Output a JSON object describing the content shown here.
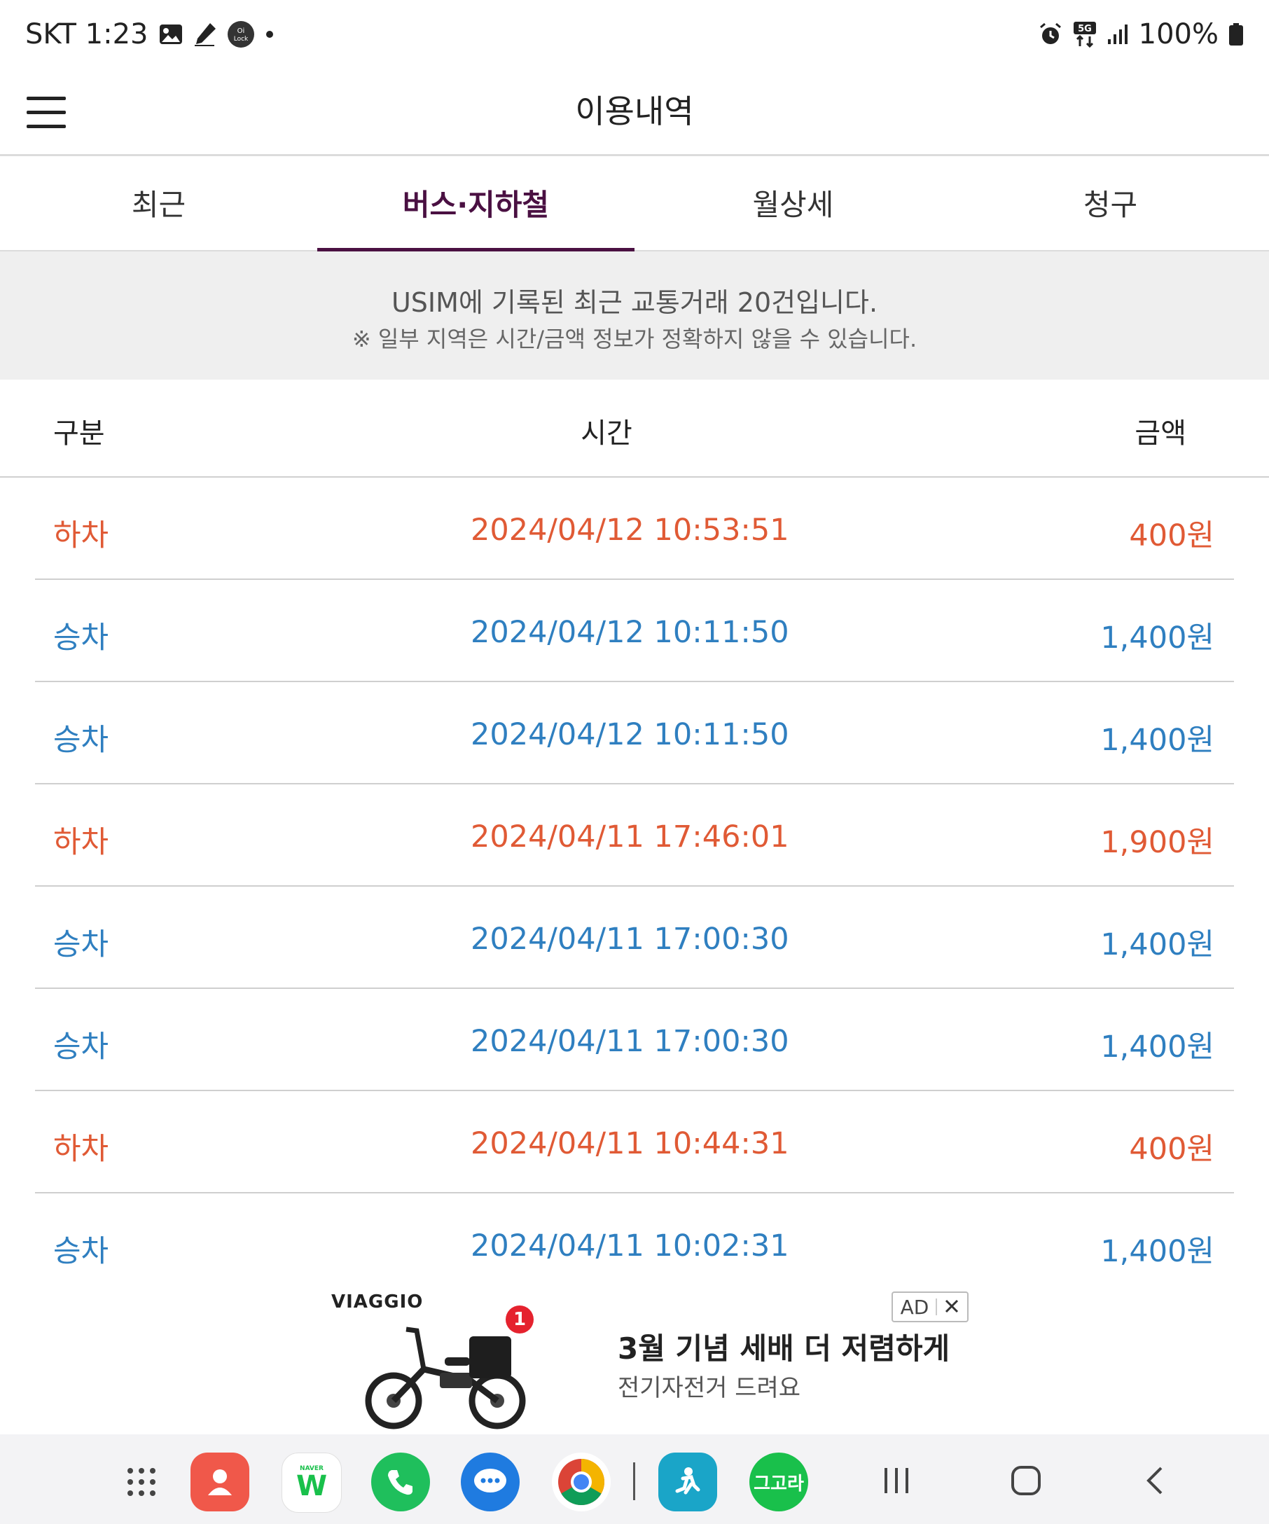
{
  "status_bar": {
    "carrier_time": "SKT 1:23",
    "battery": "100%",
    "lock_badge": "Oi Lock",
    "network": "5G",
    "icons": [
      "gallery-icon",
      "pen-icon",
      "lock-app-icon",
      "dot-icon",
      "alarm-icon",
      "5g-icon",
      "signal-icon",
      "battery-icon"
    ]
  },
  "header": {
    "title": "이용내역",
    "menu_icon": "hamburger-menu-icon"
  },
  "tabs": [
    {
      "label": "최근",
      "active": false
    },
    {
      "label": "버스·지하철",
      "active": true
    },
    {
      "label": "월상세",
      "active": false
    },
    {
      "label": "청구",
      "active": false
    }
  ],
  "notice": {
    "line1": "USIM에 기록된 최근 교통거래 20건입니다.",
    "line2": "※ 일부 지역은 시간/금액 정보가 정확하지 않을 수 있습니다."
  },
  "table": {
    "headers": {
      "type": "구분",
      "time": "시간",
      "amount": "금액"
    },
    "rows": [
      {
        "type": "하차",
        "time": "2024/04/12 10:53:51",
        "amount": "400원"
      },
      {
        "type": "승차",
        "time": "2024/04/12 10:11:50",
        "amount": "1,400원"
      },
      {
        "type": "승차",
        "time": "2024/04/12 10:11:50",
        "amount": "1,400원"
      },
      {
        "type": "하차",
        "time": "2024/04/11 17:46:01",
        "amount": "1,900원"
      },
      {
        "type": "승차",
        "time": "2024/04/11 17:00:30",
        "amount": "1,400원"
      },
      {
        "type": "승차",
        "time": "2024/04/11 17:00:30",
        "amount": "1,400원"
      },
      {
        "type": "하차",
        "time": "2024/04/11 10:44:31",
        "amount": "400원"
      },
      {
        "type": "승차",
        "time": "2024/04/11 10:02:31",
        "amount": "1,400원"
      }
    ],
    "colors": {
      "alight": "#e05a35",
      "board": "#2f7fc0"
    }
  },
  "ad": {
    "brand": "VIAGGIO",
    "badge": "AD",
    "notification_count": "1",
    "headline": "3월 기념 세배 더 저렴하게",
    "subline": "전기자전거 드려요"
  },
  "taskbar": {
    "apps": [
      {
        "name": "app-drawer-icon"
      },
      {
        "name": "contacts-icon",
        "color": "#f0584a"
      },
      {
        "name": "naver-whale-icon",
        "label": "W",
        "brand": "NAVER"
      },
      {
        "name": "phone-icon",
        "color": "#1fbf5c"
      },
      {
        "name": "messages-icon",
        "color": "#1f7be0"
      },
      {
        "name": "chrome-icon"
      },
      {
        "name": "fitness-icon",
        "color": "#1aa5c8"
      },
      {
        "name": "gogora-icon",
        "label": "그고라",
        "color": "#19c04b"
      }
    ],
    "nav": [
      "recents-icon",
      "home-icon",
      "back-icon"
    ]
  }
}
